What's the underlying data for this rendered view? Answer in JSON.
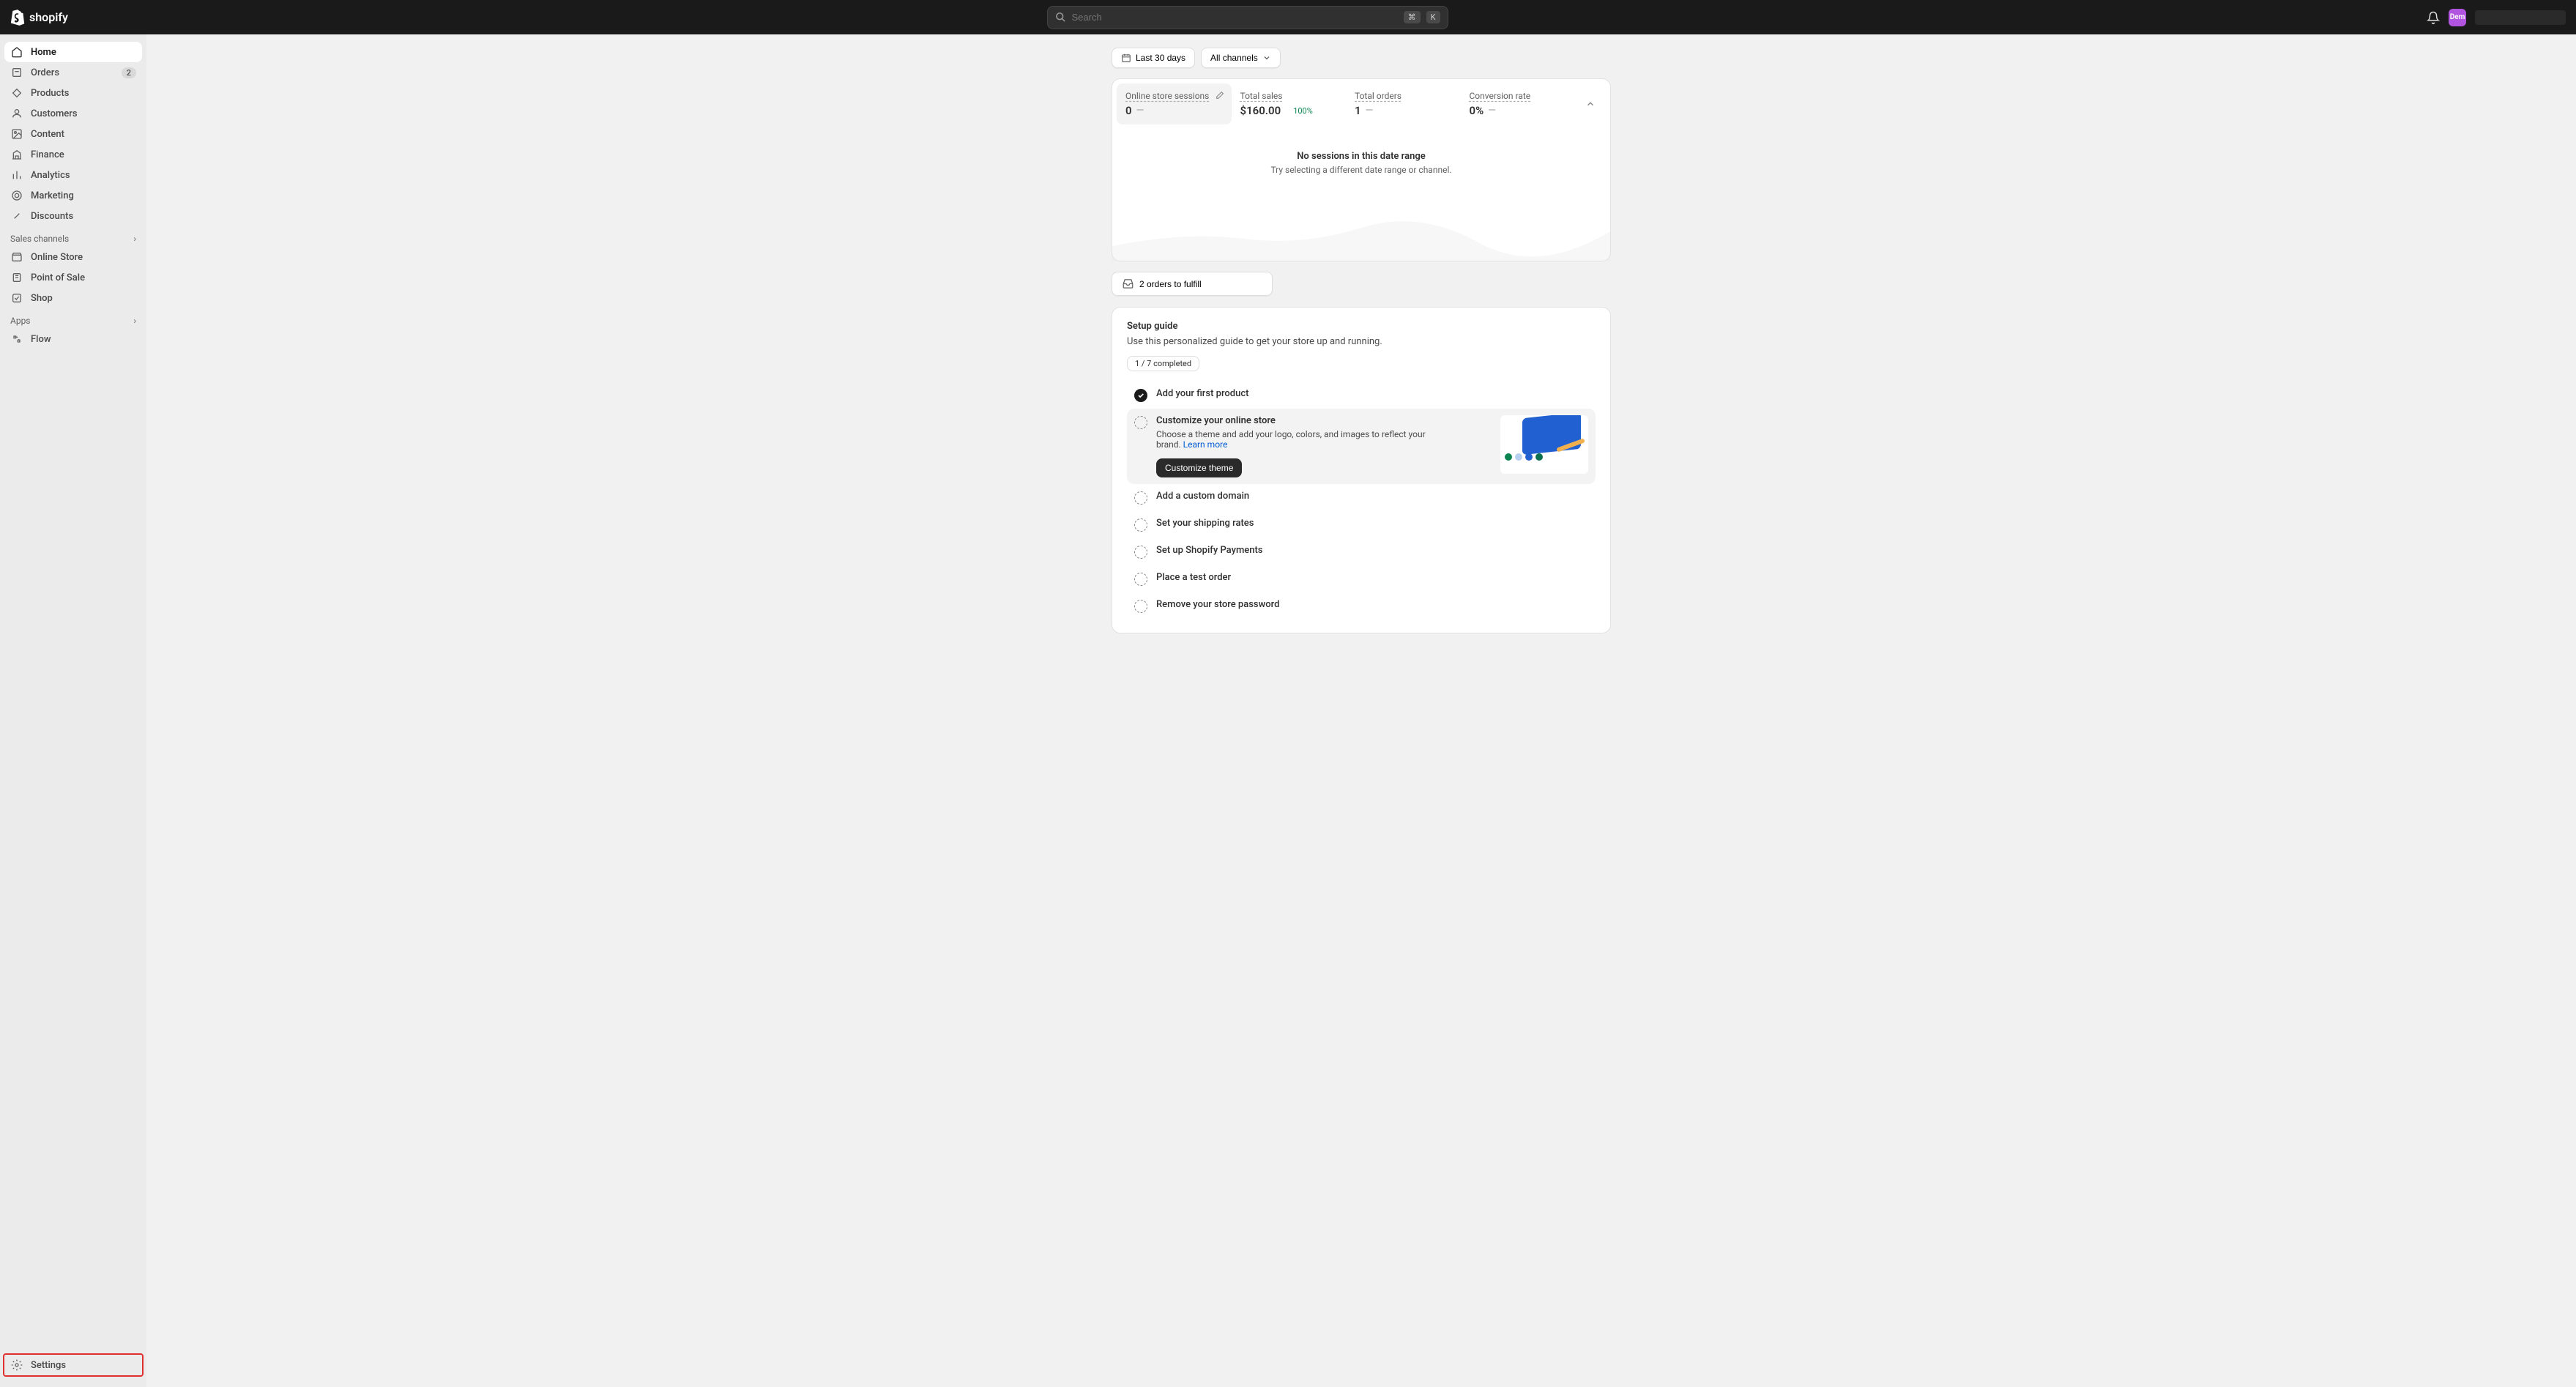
{
  "topbar": {
    "search_placeholder": "Search",
    "kbd1": "⌘",
    "kbd2": "K",
    "avatar_initials": "Dem"
  },
  "sidebar": {
    "items": [
      {
        "label": "Home",
        "icon": "home"
      },
      {
        "label": "Orders",
        "icon": "orders",
        "badge": "2"
      },
      {
        "label": "Products",
        "icon": "products"
      },
      {
        "label": "Customers",
        "icon": "customers"
      },
      {
        "label": "Content",
        "icon": "content"
      },
      {
        "label": "Finance",
        "icon": "finance"
      },
      {
        "label": "Analytics",
        "icon": "analytics"
      },
      {
        "label": "Marketing",
        "icon": "marketing"
      },
      {
        "label": "Discounts",
        "icon": "discounts"
      }
    ],
    "sales_section": "Sales channels",
    "sales_items": [
      {
        "label": "Online Store"
      },
      {
        "label": "Point of Sale"
      },
      {
        "label": "Shop"
      }
    ],
    "apps_section": "Apps",
    "apps_items": [
      {
        "label": "Flow"
      }
    ],
    "settings_label": "Settings"
  },
  "filters": {
    "date_range": "Last 30 days",
    "channel": "All channels"
  },
  "stats": [
    {
      "label": "Online store sessions",
      "value": "0",
      "change": ""
    },
    {
      "label": "Total sales",
      "value": "$160.00",
      "change": "100%"
    },
    {
      "label": "Total orders",
      "value": "1",
      "change": ""
    },
    {
      "label": "Conversion rate",
      "value": "0%",
      "change": ""
    }
  ],
  "chart": {
    "empty_title": "No sessions in this date range",
    "empty_sub": "Try selecting a different date range or channel."
  },
  "fulfill": {
    "label": "2 orders to fulfill"
  },
  "setup": {
    "title": "Setup guide",
    "desc": "Use this personalized guide to get your store up and running.",
    "progress": "1 / 7 completed",
    "tasks": [
      {
        "title": "Add your first product",
        "done": true
      },
      {
        "title": "Customize your online store",
        "expanded": true,
        "desc": "Choose a theme and add your logo, colors, and images to reflect your brand. ",
        "link": "Learn more",
        "button": "Customize theme"
      },
      {
        "title": "Add a custom domain"
      },
      {
        "title": "Set your shipping rates"
      },
      {
        "title": "Set up Shopify Payments"
      },
      {
        "title": "Place a test order"
      },
      {
        "title": "Remove your store password"
      }
    ]
  }
}
